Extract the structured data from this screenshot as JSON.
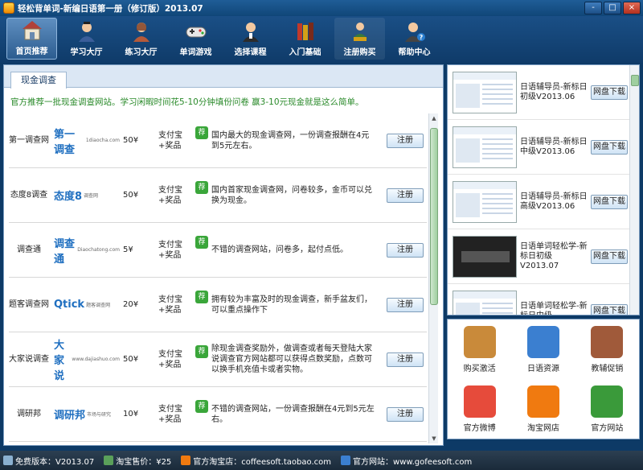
{
  "window": {
    "title": "轻松背单词-新编日语第一册（修订版）2013.07",
    "controls": [
      "-",
      "□",
      "×"
    ]
  },
  "toolbar": [
    {
      "label": "首页推荐",
      "icon": "house-icon",
      "active": true
    },
    {
      "label": "学习大厅",
      "icon": "student-icon"
    },
    {
      "label": "练习大厅",
      "icon": "teacher-icon"
    },
    {
      "label": "单词游戏",
      "icon": "gamepad-icon"
    },
    {
      "label": "选择课程",
      "icon": "user-icon"
    },
    {
      "label": "入门基础",
      "icon": "books-icon"
    },
    {
      "label": "注册购买",
      "icon": "register-icon",
      "dim": true
    },
    {
      "label": "帮助中心",
      "icon": "help-icon"
    }
  ],
  "tab": "现金调查",
  "intro": "官方推荐一批现金调查网站。学习闲暇时间花5-10分钟填份问卷 赢3-10元现金就是这么简单。",
  "surveys": [
    {
      "name": "第一调查网",
      "logo": "第一调查",
      "logo_sub": "1diaocha.com",
      "amount": "50¥",
      "pay": "支付宝+奖品",
      "badge": "荐",
      "desc": "国内最大的现金调查网，一份调查报酬在4元到5元左右。",
      "button": "注册"
    },
    {
      "name": "态度8调查",
      "logo": "态度8",
      "logo_sub": "调查网",
      "amount": "50¥",
      "pay": "支付宝+奖品",
      "badge": "荐",
      "desc": "国内首家现金调查网，问卷较多，金币可以兑换为现金。",
      "button": "注册"
    },
    {
      "name": "调查通",
      "logo": "调查通",
      "logo_sub": "Diaochatong.com",
      "amount": "5¥",
      "pay": "支付宝+奖品",
      "badge": "荐",
      "desc": "不错的调查网站，问卷多，起付点低。",
      "button": "注册"
    },
    {
      "name": "题客调查网",
      "logo": "Qtick",
      "logo_sub": "题客调查网",
      "amount": "20¥",
      "pay": "支付宝+奖品",
      "badge": "荐",
      "desc": "拥有较为丰富及时的现金调查，新手盆友们，可以重点操作下",
      "button": "注册"
    },
    {
      "name": "大家说调查",
      "logo": "大家说",
      "logo_sub": "www.dajiashuo.com",
      "amount": "50¥",
      "pay": "支付宝+奖品",
      "badge": "荐",
      "desc": "除现金调查奖励外，做调查或者每天登陆大家说调查官方网站都可以获得点数奖励，点数可以换手机充值卡或者实物。",
      "button": "注册"
    },
    {
      "name": "调研邦",
      "logo": "调研邦",
      "logo_sub": "市场与研究",
      "amount": "10¥",
      "pay": "支付宝+奖品",
      "badge": "荐",
      "desc": "不错的调查网站，一份调查报酬在4元到5元左右。",
      "button": "注册"
    }
  ],
  "downloads": [
    {
      "desc": "日语辅导员-新标日初级V2013.06",
      "button": "网盘下载"
    },
    {
      "desc": "日语辅导员-新标日中级V2013.06",
      "button": "网盘下载"
    },
    {
      "desc": "日语辅导员-新标日高级V2013.06",
      "button": "网盘下载"
    },
    {
      "desc": "日语单词轻松学-新标日初级V2013.07",
      "button": "网盘下载",
      "dark": true
    },
    {
      "desc": "日语单词轻松学-新标日中级",
      "button": "网盘下载"
    }
  ],
  "grid": [
    {
      "label": "购买激活",
      "icon": "buy-icon",
      "color": "#c98a3a"
    },
    {
      "label": "日语资源",
      "icon": "du-cloud-icon",
      "color": "#3b7fd0"
    },
    {
      "label": "教辅促销",
      "icon": "person-icon",
      "color": "#a05a3a"
    },
    {
      "label": "官方微博",
      "icon": "weibo-icon",
      "color": "#e64b3b"
    },
    {
      "label": "淘宝网店",
      "icon": "taobao-icon",
      "color": "#f07a10"
    },
    {
      "label": "官方网站",
      "icon": "house-icon",
      "color": "#3a9a3a"
    }
  ],
  "status": [
    {
      "icon": "disk-icon",
      "text": "免费版本：V2013.07"
    },
    {
      "icon": "tag-icon",
      "text": "淘宝售价：¥25"
    },
    {
      "icon": "taobao-icon",
      "text": "官方淘宝店：coffeesoft.taobao.com"
    },
    {
      "icon": "globe-icon",
      "text": "官方网站：www.gofeesoft.com"
    }
  ],
  "colors": {
    "accent": "#1a4f86",
    "intro_green": "#2a8a2a",
    "badge_green": "#3aa63a"
  }
}
